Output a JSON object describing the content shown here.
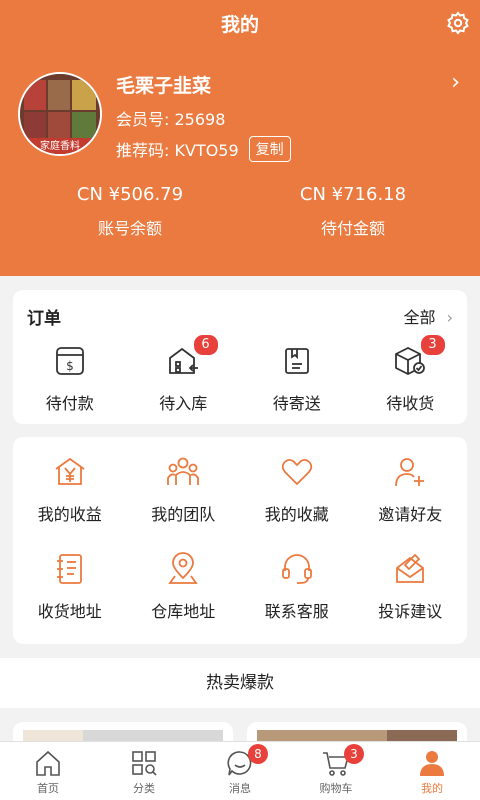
{
  "header": {
    "title": "我的",
    "user_name": "毛栗子韭菜",
    "member_label": "会员号: 25698",
    "ref_label": "推荐码: KVTO59",
    "copy_label": "复制",
    "avatar_text": "家庭香料",
    "balances": [
      {
        "value": "CN ¥506.79",
        "label": "账号余额"
      },
      {
        "value": "CN ¥716.18",
        "label": "待付金额"
      }
    ]
  },
  "orders": {
    "title": "订单",
    "all_label": "全部",
    "items": [
      {
        "label": "待付款",
        "icon": "payment-icon",
        "badge": ""
      },
      {
        "label": "待入库",
        "icon": "warehouse-in-icon",
        "badge": "6"
      },
      {
        "label": "待寄送",
        "icon": "shipping-box-icon",
        "badge": ""
      },
      {
        "label": "待收货",
        "icon": "receive-package-icon",
        "badge": "3"
      }
    ]
  },
  "services": {
    "row1": [
      {
        "label": "我的收益",
        "icon": "earnings-icon"
      },
      {
        "label": "我的团队",
        "icon": "team-icon"
      },
      {
        "label": "我的收藏",
        "icon": "heart-icon"
      },
      {
        "label": "邀请好友",
        "icon": "invite-friend-icon"
      }
    ],
    "row2": [
      {
        "label": "收货地址",
        "icon": "address-book-icon"
      },
      {
        "label": "仓库地址",
        "icon": "location-pin-icon"
      },
      {
        "label": "联系客服",
        "icon": "headset-icon"
      },
      {
        "label": "投诉建议",
        "icon": "feedback-icon"
      }
    ]
  },
  "hot": {
    "title": "热卖爆款"
  },
  "tabbar": {
    "items": [
      {
        "label": "首页",
        "icon": "home-icon",
        "badge": ""
      },
      {
        "label": "分类",
        "icon": "category-icon",
        "badge": ""
      },
      {
        "label": "消息",
        "icon": "message-icon",
        "badge": "8"
      },
      {
        "label": "购物车",
        "icon": "cart-icon",
        "badge": "3"
      },
      {
        "label": "我的",
        "icon": "profile-icon",
        "badge": ""
      }
    ]
  },
  "colors": {
    "accent": "#ea7a3f",
    "badge": "#e8403b"
  }
}
